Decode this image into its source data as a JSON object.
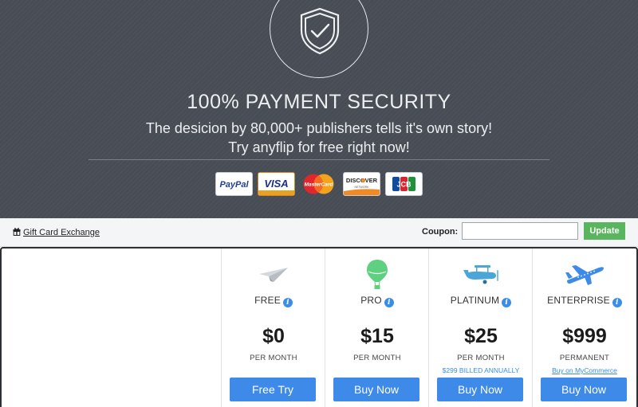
{
  "hero": {
    "title": "100% PAYMENT SECURITY",
    "subtitle_line1": "The desicion by 80,000+ publishers tells it's own story!",
    "subtitle_line2": "Try anyflip for free right now!",
    "shield_icon": "shield-check-icon",
    "payment_methods": [
      {
        "name": "PayPal",
        "icon": "paypal-logo"
      },
      {
        "name": "VISA",
        "icon": "visa-logo"
      },
      {
        "name": "MasterCard",
        "icon": "mastercard-logo"
      },
      {
        "name": "DISCOVER",
        "sub": "NETWORK",
        "icon": "discover-logo"
      },
      {
        "name": "JCB",
        "icon": "jcb-logo"
      }
    ]
  },
  "toolbar": {
    "gift_card_label": "Gift Card Exchange",
    "coupon_label": "Coupon:",
    "coupon_value": "",
    "update_label": "Update"
  },
  "plans": [
    {
      "name": "FREE",
      "price": "$0",
      "period": "PER MONTH",
      "note": "",
      "button": "Free Try",
      "icon": "paper-plane-icon",
      "icon_color": "#c9ced3"
    },
    {
      "name": "PRO",
      "price": "$15",
      "period": "PER MONTH",
      "note": "",
      "button": "Buy Now",
      "icon": "hot-air-balloon-icon",
      "icon_color": "#5fcf80"
    },
    {
      "name": "PLATINUM",
      "price": "$25",
      "period": "PER MONTH",
      "note": "$299 BILLED ANNUALLY",
      "button": "Buy Now",
      "icon": "biplane-icon",
      "icon_color": "#4ba6d8"
    },
    {
      "name": "ENTERPRISE",
      "price": "$999",
      "period": "PERMANENT",
      "note": "Buy on MyCommerce",
      "button": "Buy Now",
      "icon": "airliner-icon",
      "icon_color": "#3d8ae8"
    }
  ],
  "colors": {
    "hero_bg": "#484d55",
    "button_blue": "#3d8ae8",
    "update_green": "#5ab55f",
    "info_blue": "#3a8ee6"
  }
}
